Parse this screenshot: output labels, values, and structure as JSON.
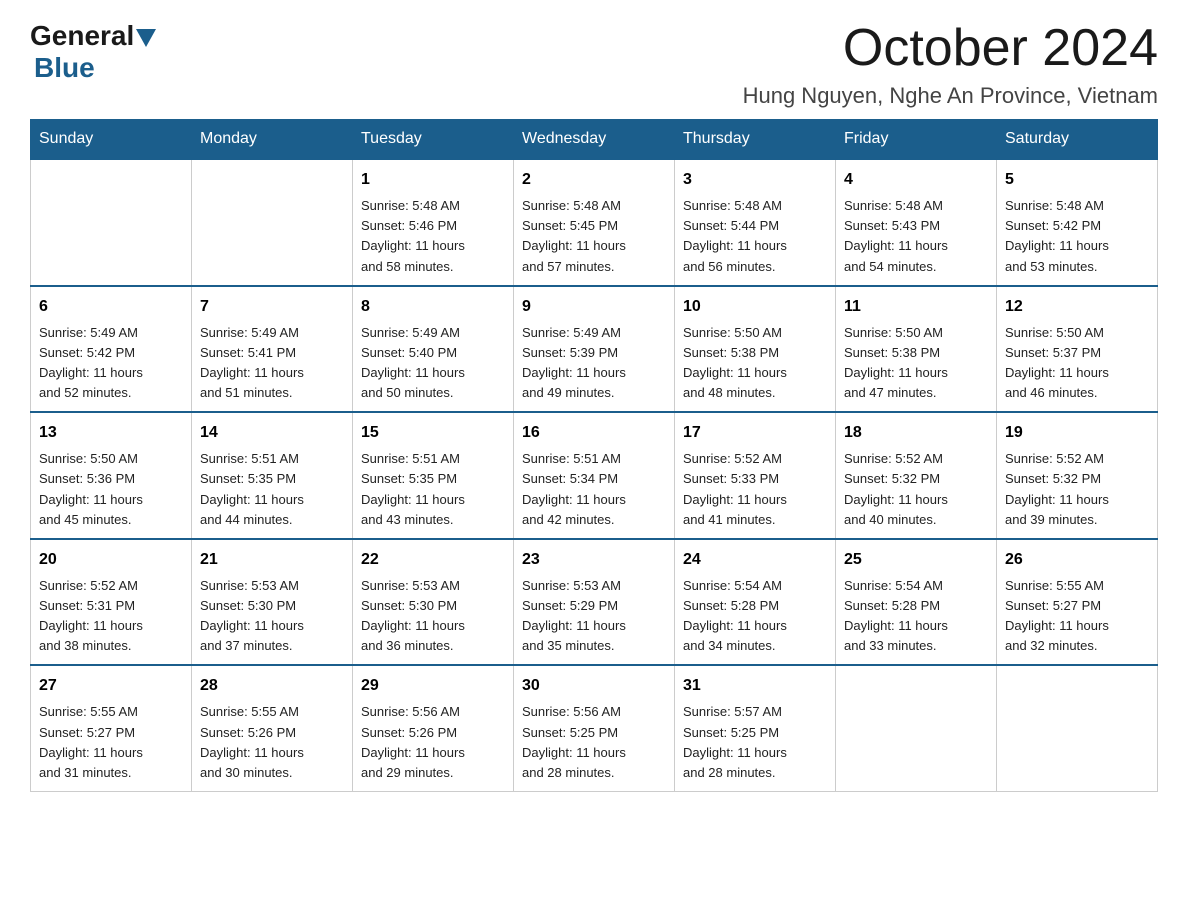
{
  "logo": {
    "general": "General",
    "blue": "Blue"
  },
  "title": "October 2024",
  "subtitle": "Hung Nguyen, Nghe An Province, Vietnam",
  "days_of_week": [
    "Sunday",
    "Monday",
    "Tuesday",
    "Wednesday",
    "Thursday",
    "Friday",
    "Saturday"
  ],
  "weeks": [
    [
      {
        "day": "",
        "info": ""
      },
      {
        "day": "",
        "info": ""
      },
      {
        "day": "1",
        "info": "Sunrise: 5:48 AM\nSunset: 5:46 PM\nDaylight: 11 hours\nand 58 minutes."
      },
      {
        "day": "2",
        "info": "Sunrise: 5:48 AM\nSunset: 5:45 PM\nDaylight: 11 hours\nand 57 minutes."
      },
      {
        "day": "3",
        "info": "Sunrise: 5:48 AM\nSunset: 5:44 PM\nDaylight: 11 hours\nand 56 minutes."
      },
      {
        "day": "4",
        "info": "Sunrise: 5:48 AM\nSunset: 5:43 PM\nDaylight: 11 hours\nand 54 minutes."
      },
      {
        "day": "5",
        "info": "Sunrise: 5:48 AM\nSunset: 5:42 PM\nDaylight: 11 hours\nand 53 minutes."
      }
    ],
    [
      {
        "day": "6",
        "info": "Sunrise: 5:49 AM\nSunset: 5:42 PM\nDaylight: 11 hours\nand 52 minutes."
      },
      {
        "day": "7",
        "info": "Sunrise: 5:49 AM\nSunset: 5:41 PM\nDaylight: 11 hours\nand 51 minutes."
      },
      {
        "day": "8",
        "info": "Sunrise: 5:49 AM\nSunset: 5:40 PM\nDaylight: 11 hours\nand 50 minutes."
      },
      {
        "day": "9",
        "info": "Sunrise: 5:49 AM\nSunset: 5:39 PM\nDaylight: 11 hours\nand 49 minutes."
      },
      {
        "day": "10",
        "info": "Sunrise: 5:50 AM\nSunset: 5:38 PM\nDaylight: 11 hours\nand 48 minutes."
      },
      {
        "day": "11",
        "info": "Sunrise: 5:50 AM\nSunset: 5:38 PM\nDaylight: 11 hours\nand 47 minutes."
      },
      {
        "day": "12",
        "info": "Sunrise: 5:50 AM\nSunset: 5:37 PM\nDaylight: 11 hours\nand 46 minutes."
      }
    ],
    [
      {
        "day": "13",
        "info": "Sunrise: 5:50 AM\nSunset: 5:36 PM\nDaylight: 11 hours\nand 45 minutes."
      },
      {
        "day": "14",
        "info": "Sunrise: 5:51 AM\nSunset: 5:35 PM\nDaylight: 11 hours\nand 44 minutes."
      },
      {
        "day": "15",
        "info": "Sunrise: 5:51 AM\nSunset: 5:35 PM\nDaylight: 11 hours\nand 43 minutes."
      },
      {
        "day": "16",
        "info": "Sunrise: 5:51 AM\nSunset: 5:34 PM\nDaylight: 11 hours\nand 42 minutes."
      },
      {
        "day": "17",
        "info": "Sunrise: 5:52 AM\nSunset: 5:33 PM\nDaylight: 11 hours\nand 41 minutes."
      },
      {
        "day": "18",
        "info": "Sunrise: 5:52 AM\nSunset: 5:32 PM\nDaylight: 11 hours\nand 40 minutes."
      },
      {
        "day": "19",
        "info": "Sunrise: 5:52 AM\nSunset: 5:32 PM\nDaylight: 11 hours\nand 39 minutes."
      }
    ],
    [
      {
        "day": "20",
        "info": "Sunrise: 5:52 AM\nSunset: 5:31 PM\nDaylight: 11 hours\nand 38 minutes."
      },
      {
        "day": "21",
        "info": "Sunrise: 5:53 AM\nSunset: 5:30 PM\nDaylight: 11 hours\nand 37 minutes."
      },
      {
        "day": "22",
        "info": "Sunrise: 5:53 AM\nSunset: 5:30 PM\nDaylight: 11 hours\nand 36 minutes."
      },
      {
        "day": "23",
        "info": "Sunrise: 5:53 AM\nSunset: 5:29 PM\nDaylight: 11 hours\nand 35 minutes."
      },
      {
        "day": "24",
        "info": "Sunrise: 5:54 AM\nSunset: 5:28 PM\nDaylight: 11 hours\nand 34 minutes."
      },
      {
        "day": "25",
        "info": "Sunrise: 5:54 AM\nSunset: 5:28 PM\nDaylight: 11 hours\nand 33 minutes."
      },
      {
        "day": "26",
        "info": "Sunrise: 5:55 AM\nSunset: 5:27 PM\nDaylight: 11 hours\nand 32 minutes."
      }
    ],
    [
      {
        "day": "27",
        "info": "Sunrise: 5:55 AM\nSunset: 5:27 PM\nDaylight: 11 hours\nand 31 minutes."
      },
      {
        "day": "28",
        "info": "Sunrise: 5:55 AM\nSunset: 5:26 PM\nDaylight: 11 hours\nand 30 minutes."
      },
      {
        "day": "29",
        "info": "Sunrise: 5:56 AM\nSunset: 5:26 PM\nDaylight: 11 hours\nand 29 minutes."
      },
      {
        "day": "30",
        "info": "Sunrise: 5:56 AM\nSunset: 5:25 PM\nDaylight: 11 hours\nand 28 minutes."
      },
      {
        "day": "31",
        "info": "Sunrise: 5:57 AM\nSunset: 5:25 PM\nDaylight: 11 hours\nand 28 minutes."
      },
      {
        "day": "",
        "info": ""
      },
      {
        "day": "",
        "info": ""
      }
    ]
  ]
}
